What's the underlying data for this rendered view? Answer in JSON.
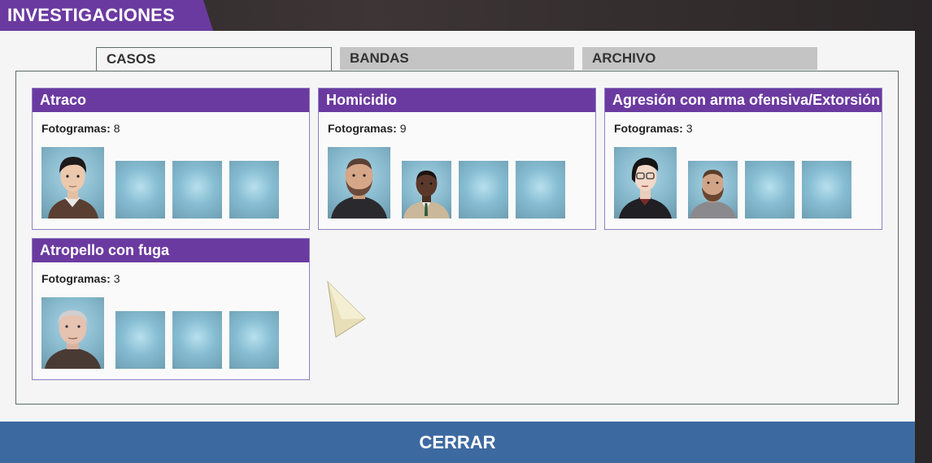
{
  "window": {
    "title": "INVESTIGACIONES"
  },
  "tabs": [
    {
      "label": "CASOS",
      "active": true
    },
    {
      "label": "BANDAS",
      "active": false
    },
    {
      "label": "ARCHIVO",
      "active": false
    }
  ],
  "frames_label": "Fotogramas:",
  "cases": [
    {
      "title": "Atraco",
      "frames": "8"
    },
    {
      "title": "Homicidio",
      "frames": "9"
    },
    {
      "title": "Agresión con arma ofensiva/Extorsión",
      "frames": "3"
    },
    {
      "title": "Atropello con fuga",
      "frames": "3"
    }
  ],
  "footer": {
    "close_label": "CERRAR"
  },
  "colors": {
    "accent": "#6b3aa0",
    "close_bar": "#3d69a1",
    "tab_inactive": "#c4c4c4"
  }
}
